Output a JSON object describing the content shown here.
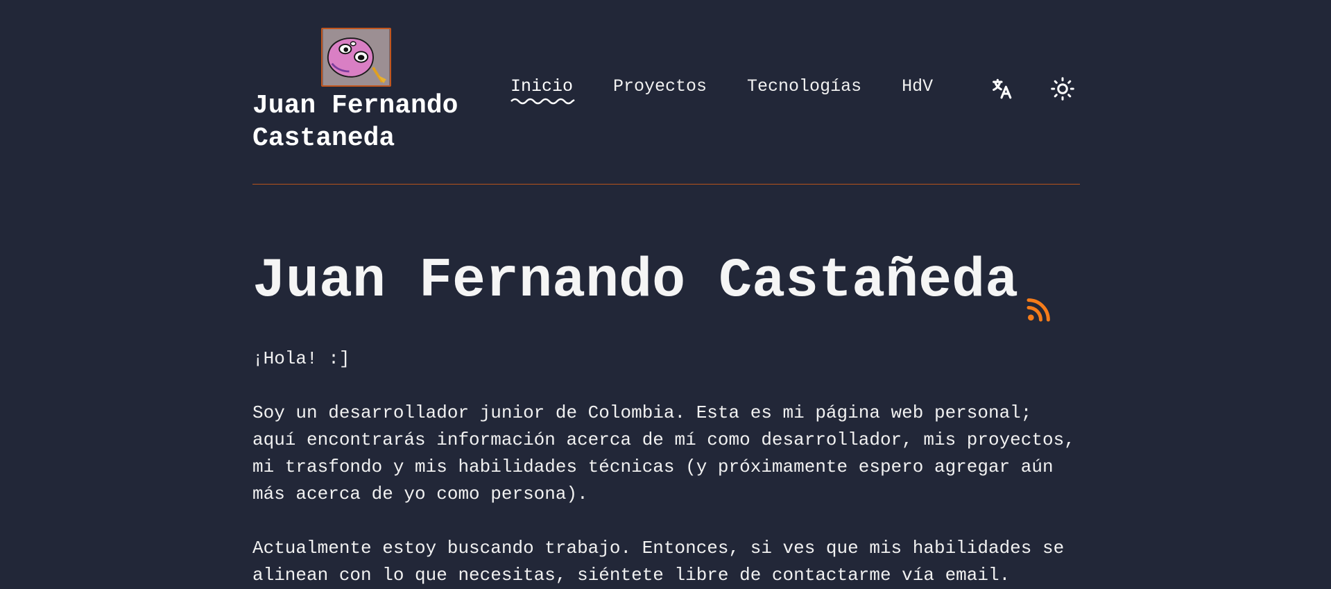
{
  "header": {
    "site_name": "Juan Fernando Castaneda",
    "logo_icon": "avatar-logo",
    "nav": [
      {
        "label": "Inicio",
        "active": true
      },
      {
        "label": "Proyectos",
        "active": false
      },
      {
        "label": "Tecnologías",
        "active": false
      },
      {
        "label": "HdV",
        "active": false
      }
    ],
    "translate_icon": "translate-icon",
    "theme_icon": "sun-icon",
    "divider_color": "#b8531b"
  },
  "main": {
    "title": "Juan Fernando Castañeda",
    "rss_icon": "rss-icon",
    "greeting": "¡Hola! :]",
    "paragraph_1": "Soy un desarrollador junior de Colombia. Esta es mi página web personal; aquí encontrarás información acerca de mí como desarrollador, mis proyectos, mi trasfondo y mis habilidades técnicas (y próximamente espero agregar aún más acerca de yo como persona).",
    "paragraph_2": "Actualmente estoy buscando trabajo. Entonces, si ves que mis habilidades se alinean con lo que necesitas, siéntete libre de contactarme vía email."
  },
  "colors": {
    "background": "#222738",
    "accent": "#c2561e",
    "rss": "#f57c1a",
    "text": "#f1f1f1"
  }
}
